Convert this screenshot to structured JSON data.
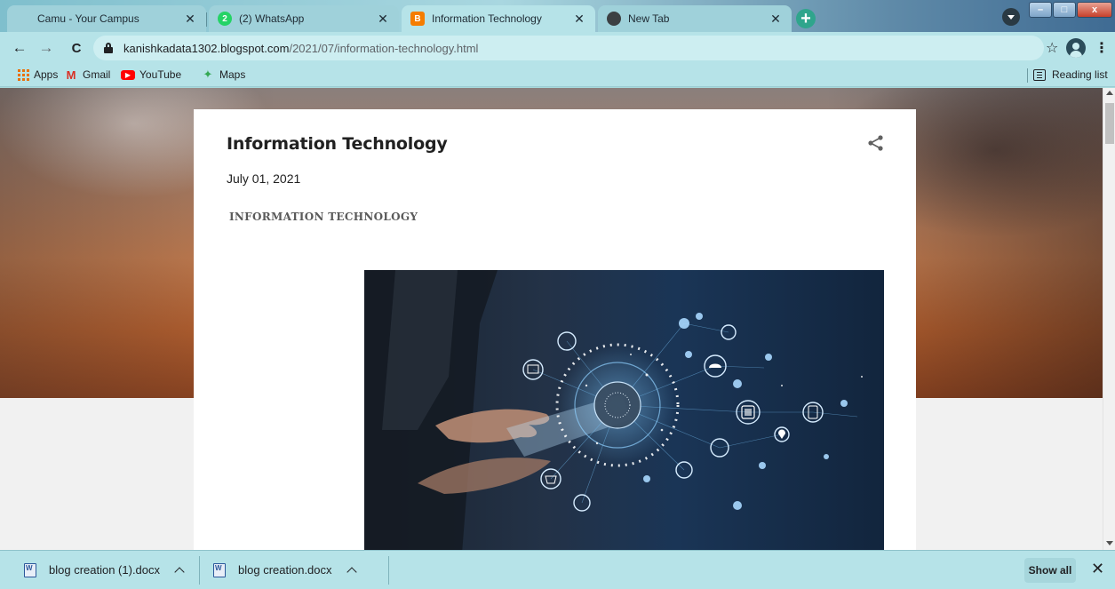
{
  "window": {
    "minimize_glyph": "–",
    "maximize_glyph": "□",
    "close_glyph": "x"
  },
  "tabs": [
    {
      "title": "Camu - Your Campus",
      "favicon": "camu-icon",
      "active": false
    },
    {
      "title": "(2) WhatsApp",
      "favicon": "whatsapp-icon",
      "badge": "2",
      "active": false
    },
    {
      "title": "Information Technology",
      "favicon": "blogger-icon",
      "active": true
    },
    {
      "title": "New Tab",
      "favicon": "chrome-icon",
      "active": false
    }
  ],
  "tab_close_glyph": "✕",
  "new_tab_glyph": "+",
  "toolbar": {
    "back_glyph": "←",
    "forward_glyph": "→",
    "reload_glyph": "C",
    "url_host": "kanishkadata1302.blogspot.com",
    "url_path": "/2021/07/information-technology.html",
    "star_glyph": "☆",
    "menu_glyph": "⋮"
  },
  "bookmarks": [
    {
      "label": "Apps",
      "icon": "apps-grid-icon"
    },
    {
      "label": "Gmail",
      "icon": "gmail-icon",
      "glyph": "M"
    },
    {
      "label": "YouTube",
      "icon": "youtube-icon",
      "glyph": "▶"
    },
    {
      "label": "Maps",
      "icon": "maps-icon",
      "glyph": "✦"
    }
  ],
  "reading_list": "Reading list",
  "post": {
    "title": "Information Technology",
    "date": "July 01, 2021",
    "heading": "INFORMATION TECHNOLOGY"
  },
  "downloads": [
    {
      "filename": "blog creation (1).docx"
    },
    {
      "filename": "blog creation.docx"
    }
  ],
  "show_all": "Show all",
  "shelf_close_glyph": "✕",
  "colors": {
    "accent_whatsapp": "#25d366",
    "accent_blogger": "#f57d00",
    "new_tab_button": "#2fa58c",
    "browser_theme": "#b6e3e8"
  }
}
